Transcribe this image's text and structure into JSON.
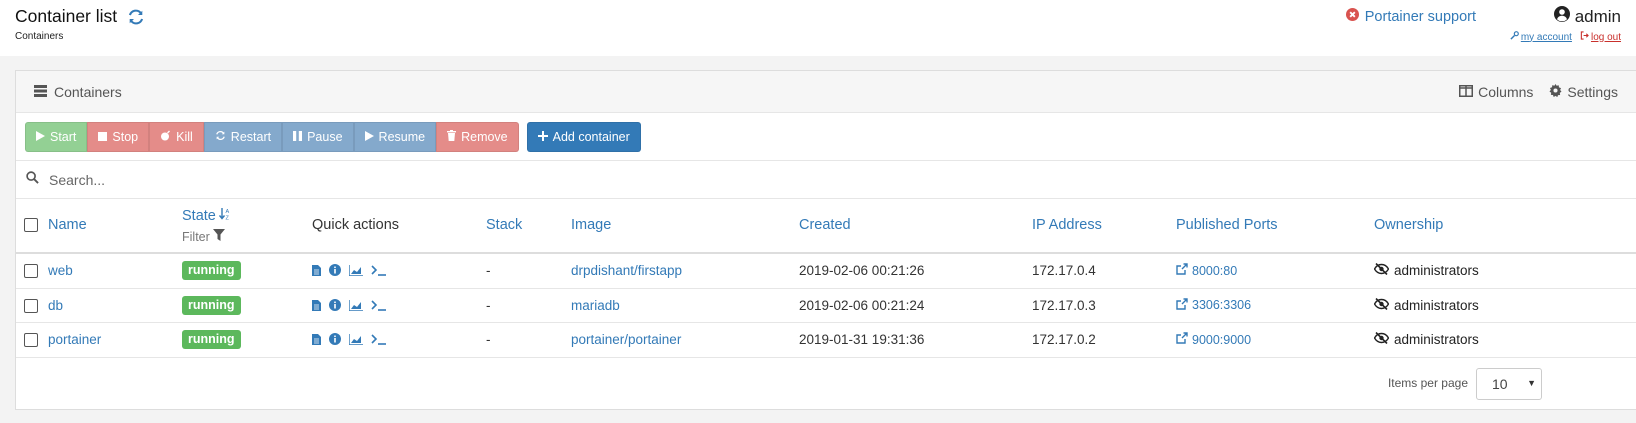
{
  "header": {
    "title": "Container list",
    "breadcrumb": "Containers",
    "support_label": "Portainer support",
    "user": "admin",
    "my_account": "my account",
    "log_out": "log out"
  },
  "widget": {
    "title": "Containers",
    "columns_label": "Columns",
    "settings_label": "Settings"
  },
  "actions": {
    "start": "Start",
    "stop": "Stop",
    "kill": "Kill",
    "restart": "Restart",
    "pause": "Pause",
    "resume": "Resume",
    "remove": "Remove",
    "add": "Add container"
  },
  "search": {
    "placeholder": "Search..."
  },
  "table": {
    "headers": {
      "name": "Name",
      "state": "State",
      "state_filter": "Filter",
      "quick_actions": "Quick actions",
      "stack": "Stack",
      "image": "Image",
      "created": "Created",
      "ip": "IP Address",
      "ports": "Published Ports",
      "ownership": "Ownership"
    },
    "rows": [
      {
        "name": "web",
        "state": "running",
        "stack": "-",
        "image": "drpdishant/firstapp",
        "created": "2019-02-06 00:21:26",
        "ip": "172.17.0.4",
        "ports": "8000:80",
        "ownership": "administrators"
      },
      {
        "name": "db",
        "state": "running",
        "stack": "-",
        "image": "mariadb",
        "created": "2019-02-06 00:21:24",
        "ip": "172.17.0.3",
        "ports": "3306:3306",
        "ownership": "administrators"
      },
      {
        "name": "portainer",
        "state": "running",
        "stack": "-",
        "image": "portainer/portainer",
        "created": "2019-01-31 19:31:36",
        "ip": "172.17.0.2",
        "ports": "9000:9000",
        "ownership": "administrators"
      }
    ]
  },
  "footer": {
    "items_per_page_label": "Items per page",
    "items_per_page_value": "10"
  },
  "colors": {
    "primary": "#337ab7",
    "success": "#5cb85c",
    "danger": "#d9534f"
  }
}
